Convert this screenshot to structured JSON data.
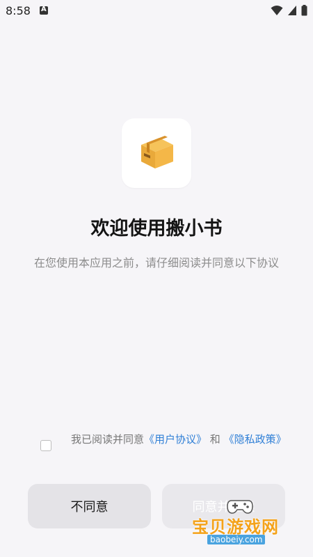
{
  "status_bar": {
    "time": "8:58",
    "icons": [
      "a-icon",
      "wifi-icon",
      "signal-icon",
      "battery-icon"
    ]
  },
  "app": {
    "icon": "package-box-icon"
  },
  "welcome": {
    "title": "欢迎使用搬小书",
    "intro": "在您使用本应用之前，请仔细阅读并同意以下协议"
  },
  "agreement": {
    "checked": false,
    "prefix": "我已阅读并同意",
    "user_agreement": "《用户协议》",
    "conjunction": " 和 ",
    "privacy_policy": "《隐私政策》"
  },
  "buttons": {
    "disagree_label": "不同意",
    "agree_label": "同意并继续"
  },
  "watermark": {
    "text": "宝贝游戏网",
    "url": "baobeiy.com"
  },
  "colors": {
    "background": "#f6f5f8",
    "link": "#2f7fd6",
    "title": "#141414",
    "watermark": "#f4a21a"
  }
}
